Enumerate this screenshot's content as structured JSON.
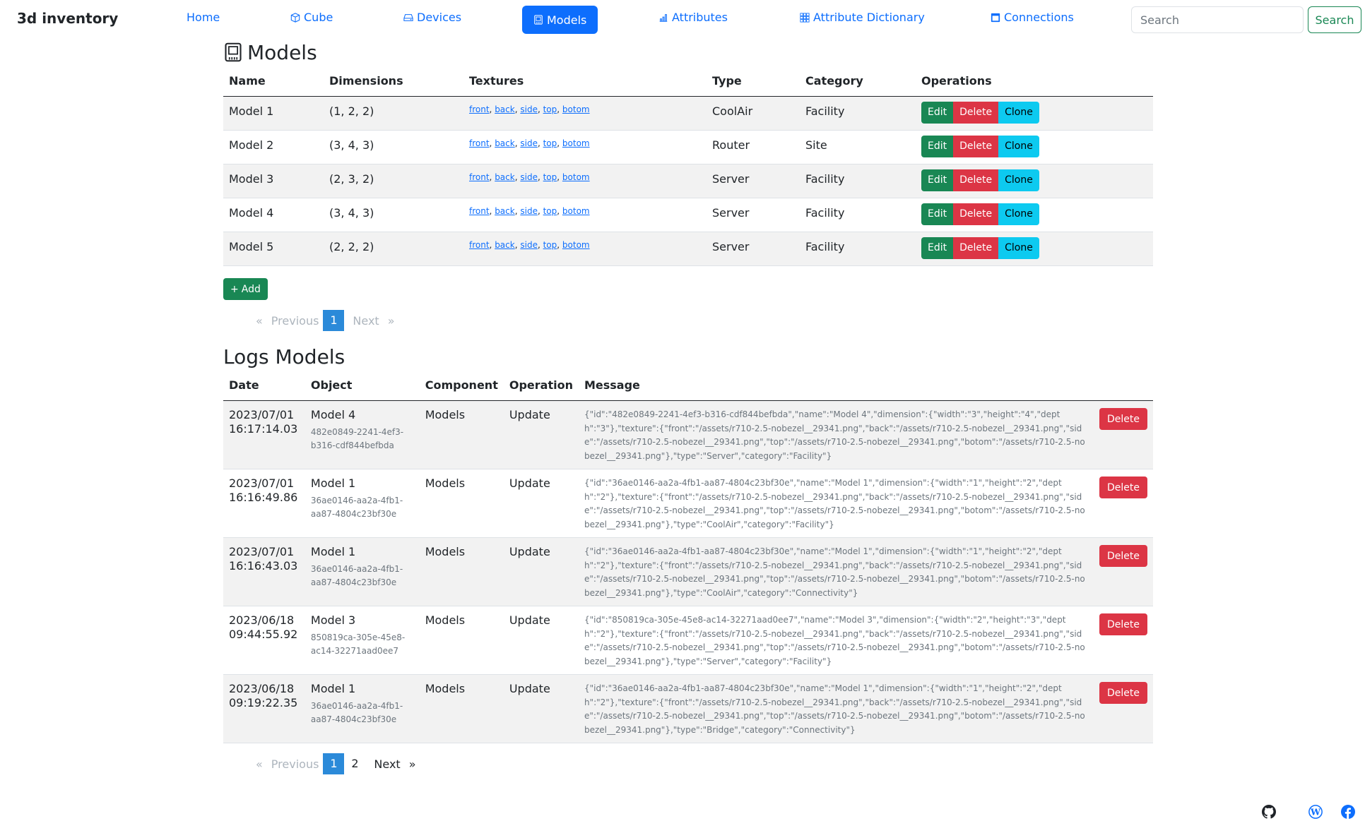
{
  "brand": "3d inventory",
  "nav": {
    "home": "Home",
    "cube": "Cube",
    "devices": "Devices",
    "models": "Models",
    "attributes": "Attributes",
    "attribute_dictionary": "Attribute Dictionary",
    "connections": "Connections"
  },
  "search": {
    "placeholder": "Search",
    "button": "Search"
  },
  "models": {
    "title": "Models",
    "headers": [
      "Name",
      "Dimensions",
      "Textures",
      "Type",
      "Category",
      "Operations"
    ],
    "texture_links": [
      "front",
      "back",
      "side",
      "top",
      "botom"
    ],
    "ops": {
      "edit": "Edit",
      "delete": "Delete",
      "clone": "Clone"
    },
    "rows": [
      {
        "name": "Model 1",
        "dimensions": "(1, 2, 2)",
        "type": "CoolAir",
        "category": "Facility"
      },
      {
        "name": "Model 2",
        "dimensions": "(3, 4, 3)",
        "type": "Router",
        "category": "Site"
      },
      {
        "name": "Model 3",
        "dimensions": "(2, 3, 2)",
        "type": "Server",
        "category": "Facility"
      },
      {
        "name": "Model 4",
        "dimensions": "(3, 4, 3)",
        "type": "Server",
        "category": "Facility"
      },
      {
        "name": "Model 5",
        "dimensions": "(2, 2, 2)",
        "type": "Server",
        "category": "Facility"
      }
    ],
    "add_label": "Add",
    "pagination": {
      "first": "«",
      "previous": "Previous",
      "current": "1",
      "next": "Next",
      "last": "»"
    }
  },
  "logs": {
    "title": "Logs Models",
    "headers": [
      "Date",
      "Object",
      "Component",
      "Operation",
      "Message"
    ],
    "delete_label": "Delete",
    "rows": [
      {
        "date": "2023/07/01",
        "time": "16:17:14.03",
        "object": "Model 4",
        "id": "482e0849-2241-4ef3-b316-cdf844befbda",
        "component": "Models",
        "operation": "Update",
        "message": "{\"id\":\"482e0849-2241-4ef3-b316-cdf844befbda\",\"name\":\"Model 4\",\"dimension\":{\"width\":\"3\",\"height\":\"4\",\"depth\":\"3\"},\"texture\":{\"front\":\"/assets/r710-2.5-nobezel__29341.png\",\"back\":\"/assets/r710-2.5-nobezel__29341.png\",\"side\":\"/assets/r710-2.5-nobezel__29341.png\",\"top\":\"/assets/r710-2.5-nobezel__29341.png\",\"botom\":\"/assets/r710-2.5-nobezel__29341.png\"},\"type\":\"Server\",\"category\":\"Facility\"}"
      },
      {
        "date": "2023/07/01",
        "time": "16:16:49.86",
        "object": "Model 1",
        "id": "36ae0146-aa2a-4fb1-aa87-4804c23bf30e",
        "component": "Models",
        "operation": "Update",
        "message": "{\"id\":\"36ae0146-aa2a-4fb1-aa87-4804c23bf30e\",\"name\":\"Model 1\",\"dimension\":{\"width\":\"1\",\"height\":\"2\",\"depth\":\"2\"},\"texture\":{\"front\":\"/assets/r710-2.5-nobezel__29341.png\",\"back\":\"/assets/r710-2.5-nobezel__29341.png\",\"side\":\"/assets/r710-2.5-nobezel__29341.png\",\"top\":\"/assets/r710-2.5-nobezel__29341.png\",\"botom\":\"/assets/r710-2.5-nobezel__29341.png\"},\"type\":\"CoolAir\",\"category\":\"Facility\"}"
      },
      {
        "date": "2023/07/01",
        "time": "16:16:43.03",
        "object": "Model 1",
        "id": "36ae0146-aa2a-4fb1-aa87-4804c23bf30e",
        "component": "Models",
        "operation": "Update",
        "message": "{\"id\":\"36ae0146-aa2a-4fb1-aa87-4804c23bf30e\",\"name\":\"Model 1\",\"dimension\":{\"width\":\"1\",\"height\":\"2\",\"depth\":\"2\"},\"texture\":{\"front\":\"/assets/r710-2.5-nobezel__29341.png\",\"back\":\"/assets/r710-2.5-nobezel__29341.png\",\"side\":\"/assets/r710-2.5-nobezel__29341.png\",\"top\":\"/assets/r710-2.5-nobezel__29341.png\",\"botom\":\"/assets/r710-2.5-nobezel__29341.png\"},\"type\":\"CoolAir\",\"category\":\"Connectivity\"}"
      },
      {
        "date": "2023/06/18",
        "time": "09:44:55.92",
        "object": "Model 3",
        "id": "850819ca-305e-45e8-ac14-32271aad0ee7",
        "component": "Models",
        "operation": "Update",
        "message": "{\"id\":\"850819ca-305e-45e8-ac14-32271aad0ee7\",\"name\":\"Model 3\",\"dimension\":{\"width\":\"2\",\"height\":\"3\",\"depth\":\"2\"},\"texture\":{\"front\":\"/assets/r710-2.5-nobezel__29341.png\",\"back\":\"/assets/r710-2.5-nobezel__29341.png\",\"side\":\"/assets/r710-2.5-nobezel__29341.png\",\"top\":\"/assets/r710-2.5-nobezel__29341.png\",\"botom\":\"/assets/r710-2.5-nobezel__29341.png\"},\"type\":\"Server\",\"category\":\"Facility\"}"
      },
      {
        "date": "2023/06/18",
        "time": "09:19:22.35",
        "object": "Model 1",
        "id": "36ae0146-aa2a-4fb1-aa87-4804c23bf30e",
        "component": "Models",
        "operation": "Update",
        "message": "{\"id\":\"36ae0146-aa2a-4fb1-aa87-4804c23bf30e\",\"name\":\"Model 1\",\"dimension\":{\"width\":\"1\",\"height\":\"2\",\"depth\":\"2\"},\"texture\":{\"front\":\"/assets/r710-2.5-nobezel__29341.png\",\"back\":\"/assets/r710-2.5-nobezel__29341.png\",\"side\":\"/assets/r710-2.5-nobezel__29341.png\",\"top\":\"/assets/r710-2.5-nobezel__29341.png\",\"botom\":\"/assets/r710-2.5-nobezel__29341.png\"},\"type\":\"Bridge\",\"category\":\"Connectivity\"}"
      }
    ],
    "pagination": {
      "first": "«",
      "previous": "Previous",
      "current": "1",
      "page2": "2",
      "next": "Next",
      "last": "»"
    }
  },
  "footer": {
    "icons": [
      "github-icon",
      "wordpress-icon",
      "facebook-icon"
    ]
  }
}
